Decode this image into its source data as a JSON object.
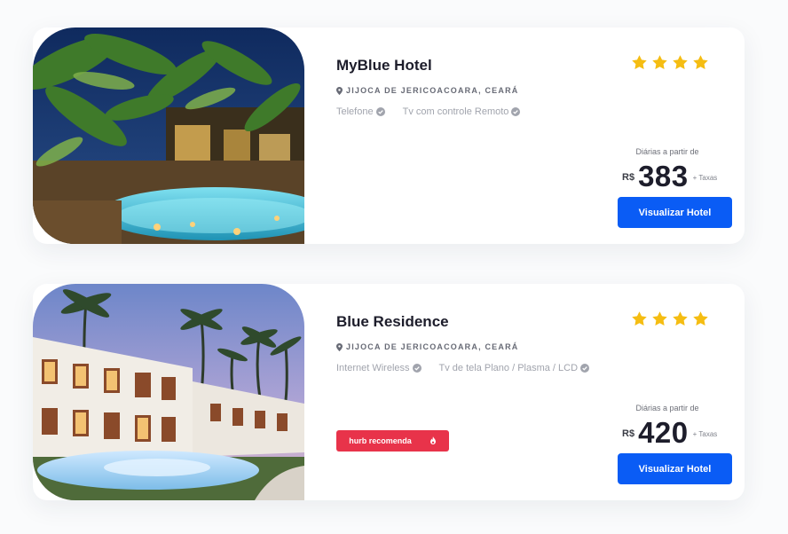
{
  "colors": {
    "accent": "#0a5cf5",
    "star": "#f5bd12",
    "badge": "#e8334a",
    "check": "#a1a4ad"
  },
  "hotels": [
    {
      "name": "MyBlue Hotel",
      "location": "JIJOCA DE JERICOACOARA, CEARÁ",
      "amenities": [
        "Telefone",
        "Tv com controle Remoto"
      ],
      "stars": 4,
      "price_caption": "Diárias a partir de",
      "currency": "R$",
      "price": "383",
      "taxes": "+ Taxas",
      "button_label": "Visualizar Hotel",
      "image_icon": "hotel-photo-tropical-pool-night"
    },
    {
      "name": "Blue Residence",
      "location": "JIJOCA DE JERICOACOARA, CEARÁ",
      "amenities": [
        "Internet Wireless",
        "Tv de tela Plano / Plasma / LCD"
      ],
      "stars": 4,
      "price_caption": "Diárias a partir de",
      "currency": "R$",
      "price": "420",
      "taxes": "+ Taxas",
      "button_label": "Visualizar Hotel",
      "badge": "hurb recomenda",
      "image_icon": "hotel-photo-resort-pool-dusk"
    }
  ]
}
